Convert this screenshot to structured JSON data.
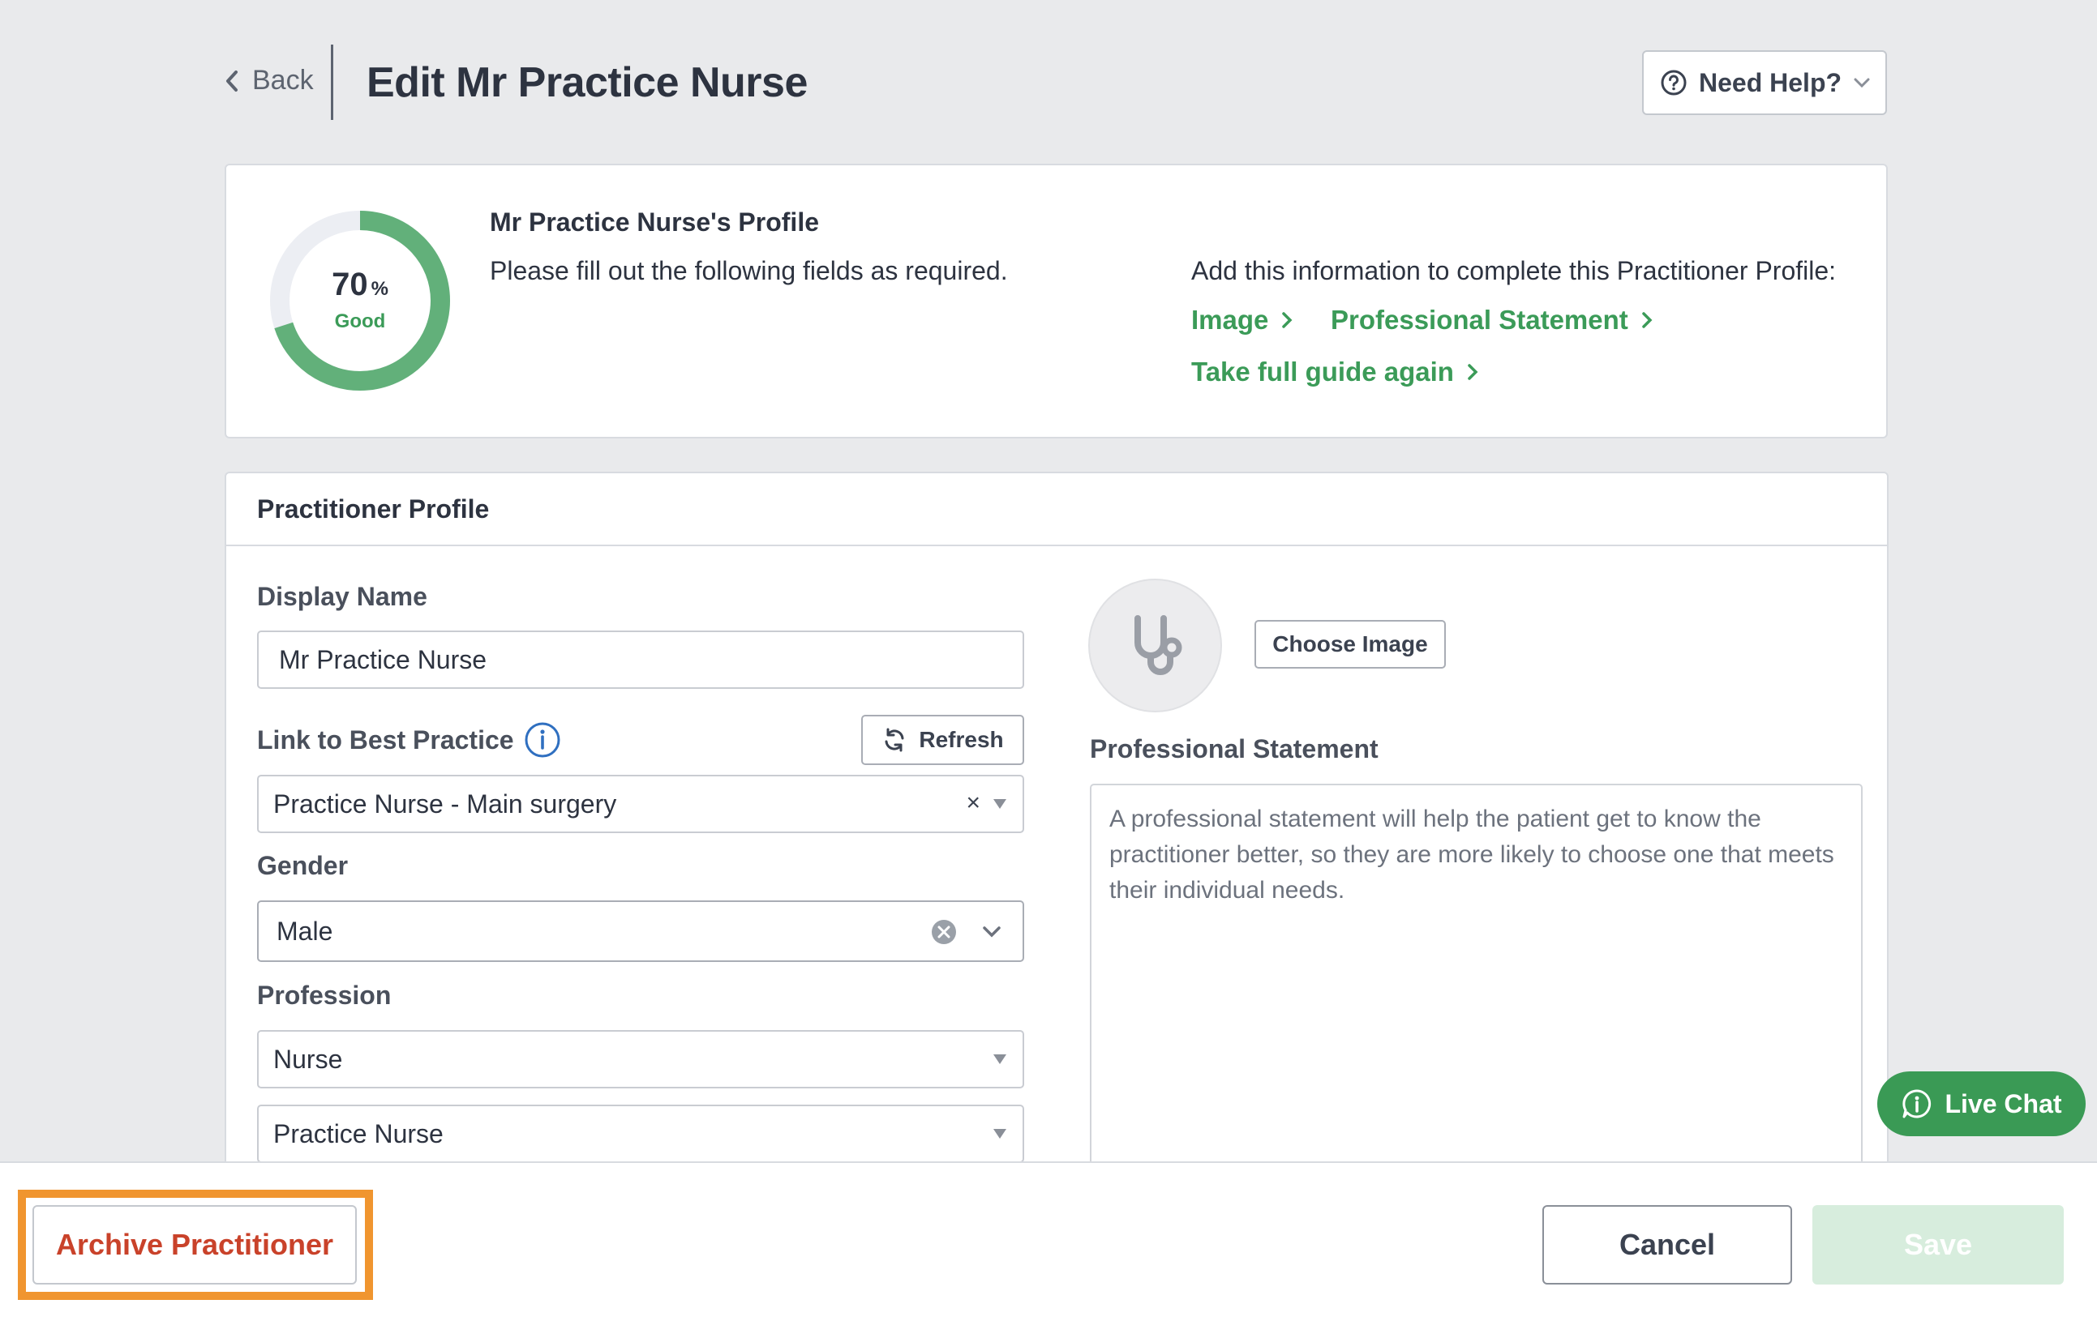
{
  "header": {
    "back_label": "Back",
    "title": "Edit Mr Practice Nurse",
    "help_label": "Need Help?"
  },
  "completion": {
    "percent": 70,
    "percent_text": "70",
    "percent_symbol": "%",
    "rating": "Good",
    "heading": "Mr Practice Nurse's Profile",
    "subtext": "Please fill out the following fields as required.",
    "info_text": "Add this information to complete this Practitioner Profile:",
    "links": {
      "image": "Image",
      "statement": "Professional Statement",
      "guide": "Take full guide again"
    }
  },
  "profile": {
    "section_title": "Practitioner Profile",
    "display_name_label": "Display Name",
    "display_name_value": "Mr Practice Nurse",
    "link_label": "Link to Best Practice",
    "refresh_label": "Refresh",
    "link_value": "Practice Nurse - Main surgery",
    "gender_label": "Gender",
    "gender_value": "Male",
    "profession_label": "Profession",
    "profession_value": "Nurse",
    "profession_sub_value": "Practice Nurse",
    "choose_image_label": "Choose Image",
    "statement_label": "Professional Statement",
    "statement_placeholder": "A professional statement will help the patient get to know the practitioner better, so they are more likely to choose one that meets their individual needs."
  },
  "live_chat_label": "Live Chat",
  "footer": {
    "archive_label": "Archive Practitioner",
    "cancel_label": "Cancel",
    "save_label": "Save"
  },
  "colors": {
    "accent_green": "#3b9b58",
    "archive_red": "#c9422a",
    "highlight_orange": "#f0952f"
  }
}
